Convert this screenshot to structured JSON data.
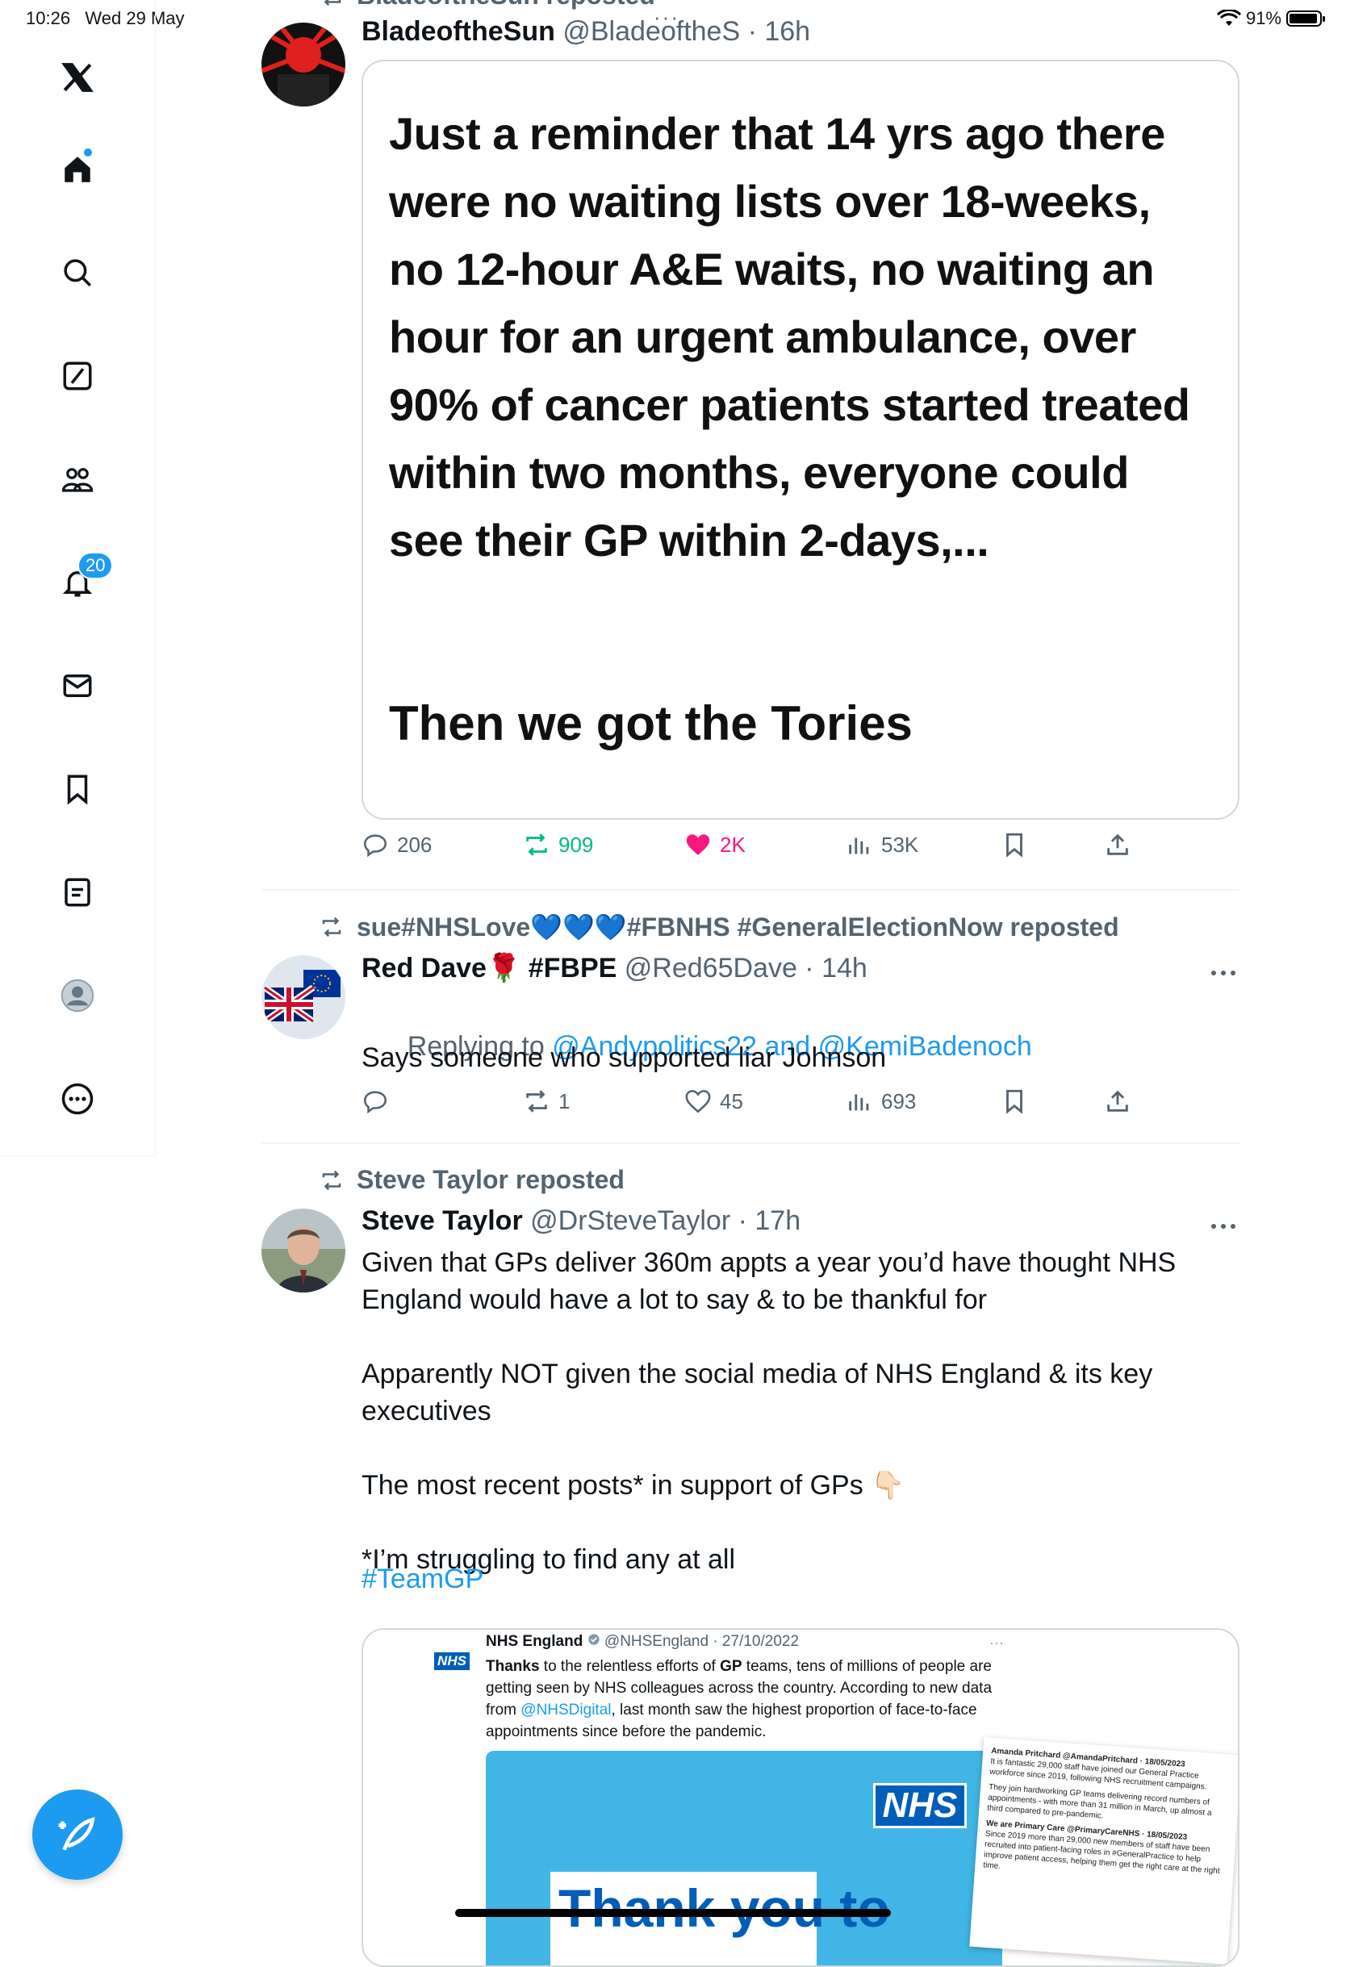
{
  "status_bar": {
    "time": "10:26",
    "date": "Wed 29 May",
    "battery": "91%"
  },
  "sidebar": {
    "notifications_badge": "20"
  },
  "tweets": [
    {
      "repost_by": "BladeoftheSun reposted",
      "name": "BladeoftheSun",
      "handle": "@BladeoftheS",
      "time": "16h",
      "meme_text": "Just a reminder that 14 yrs ago there were no waiting lists over 18-weeks, no 12-hour A&E waits, no waiting an hour for an urgent ambulance, over 90% of cancer patients started treated within two months, everyone could see their GP within 2-days,...",
      "meme_footer": "Then we got the Tories",
      "replies": "206",
      "reposts": "909",
      "likes": "2K",
      "views": "53K"
    },
    {
      "repost_by": "sue#NHSLove💙💙💙#FBNHS #GeneralElectionNow reposted",
      "name": "Red Dave🌹 #FBPE",
      "handle": "@Red65Dave",
      "time": "14h",
      "replying_prefix": "Replying to",
      "replying_to": "@Andypolitics22 and @KemiBadenoch",
      "text": "Says someone who supported liar Johnson",
      "replies": "",
      "reposts": "1",
      "likes": "45",
      "views": "693"
    },
    {
      "repost_by": "Steve Taylor reposted",
      "name": "Steve Taylor",
      "handle": "@DrSteveTaylor",
      "time": "17h",
      "text": "Given that GPs deliver 360m appts a year you’d have thought NHS England would have a lot to say & to be thankful for\n\nApparently NOT given the social media of NHS England & its key executives\n\nThe most recent posts* in support of GPs 👇🏻\n\n*I’m struggling to find any at all",
      "hashtag": "#TeamGP",
      "embed": {
        "name": "NHS England",
        "handle": "@NHSEngland · 27/10/2022",
        "text_prefix": "Thanks",
        "text_mid1": " to the relentless efforts of ",
        "text_gp": "GP",
        "text_mid2": " teams, tens of millions of people are getting seen by NHS colleagues across the country. According to new data from ",
        "text_link": "@NHSDigital",
        "text_end": ", last month saw the highest proportion of face-to-face appointments since before the pandemic.",
        "logo": "NHS",
        "banner_text": "Thank you to",
        "side_card_1": "Amanda Pritchard @AmandaPritchard · 18/05/2023",
        "side_card_2": "It is fantastic 29,000 staff have joined our General Practice workforce since 2019, following NHS recruitment campaigns.",
        "side_card_3": "They join hardworking GP teams delivering record numbers of appointments - with more than 31 million in March, up almost a third compared to pre-pandemic.",
        "side_card_4": "We are Primary Care @PrimaryCareNHS · 18/05/2023",
        "side_card_5": "Since 2019 more than 29,000 new members of staff have been recruited into patient-facing roles in #GeneralPractice to help improve patient access, helping them get the right care at the right time."
      }
    }
  ],
  "colors": {
    "accent": "#1d9bf0",
    "like": "#f91880",
    "repost": "#00ba7c",
    "muted": "#536471"
  }
}
